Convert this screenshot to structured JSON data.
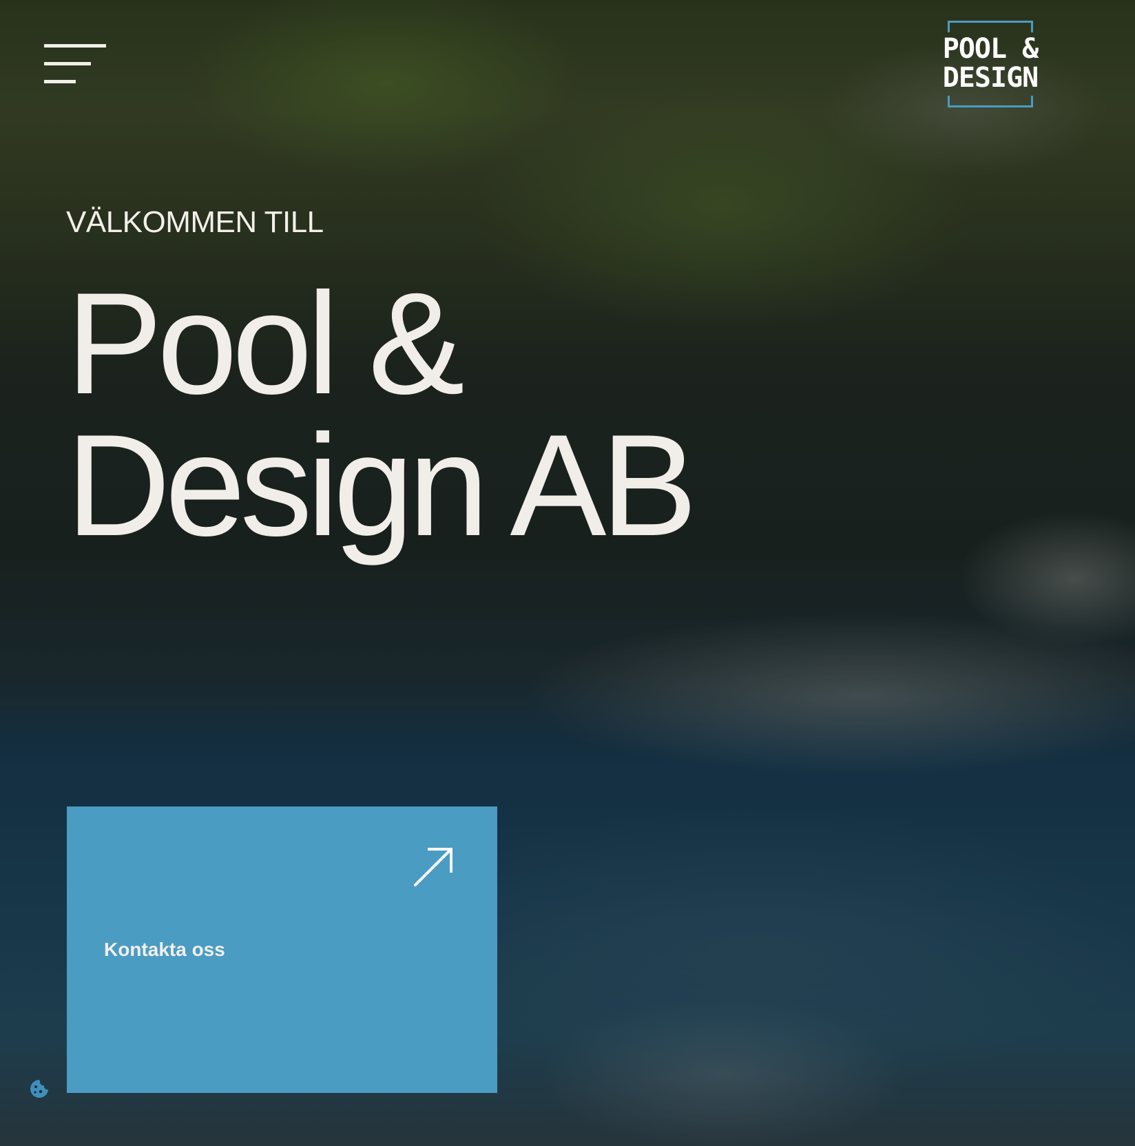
{
  "header": {
    "menu_icon": "hamburger-menu-icon",
    "logo": {
      "line1": "POOL &",
      "line2": "DESIGN",
      "bracket_color": "#4a9cc3",
      "text_color": "#ffffff"
    }
  },
  "hero": {
    "eyebrow": "VÄLKOMMEN TILL",
    "title_line1": "Pool &",
    "title_line2": "Design AB"
  },
  "cta": {
    "label": "Kontakta oss",
    "icon": "arrow-up-right-icon",
    "background_color": "#4a9cc3"
  },
  "cookie": {
    "icon": "cookie-icon",
    "color": "#3e8fbd"
  },
  "colors": {
    "text_light": "#f1ede8",
    "accent": "#4a9cc3"
  }
}
